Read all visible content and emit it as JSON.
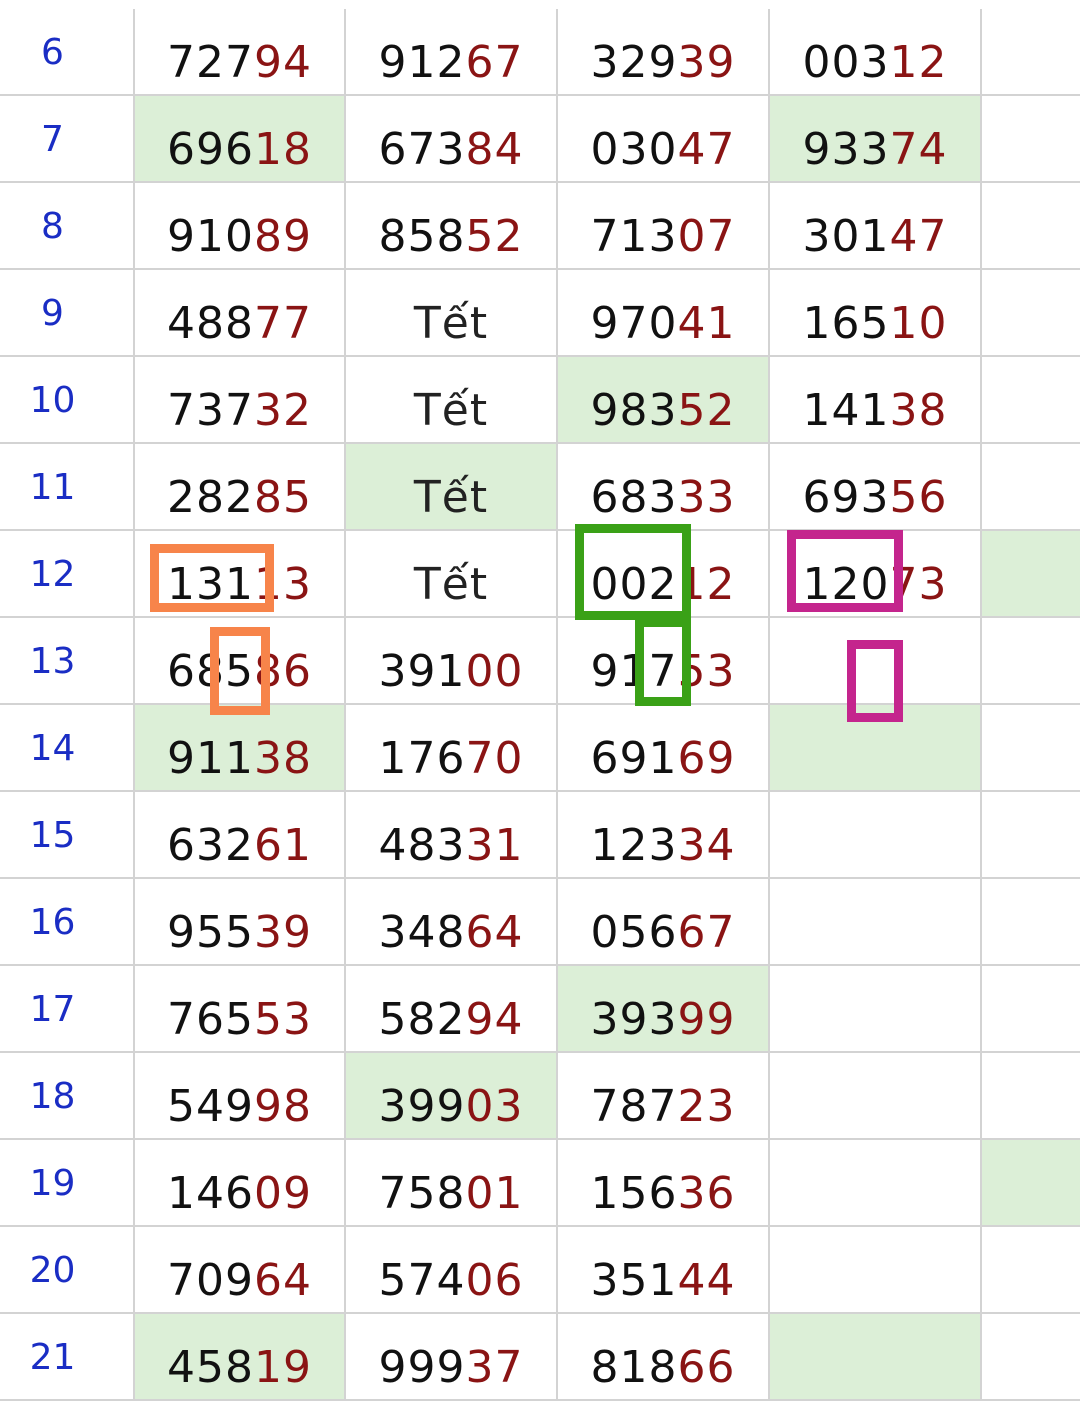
{
  "colors": {
    "day_text": "#1a2dc4",
    "number_text": "#111111",
    "tail_text": "#8a1414",
    "highlight_fill": "#dcefd7",
    "grid_line": "#d3d3d3",
    "mark_orange": "#f7844a",
    "mark_green": "#3aa117",
    "mark_magenta": "#c4258d"
  },
  "rows": [
    {
      "day": "6",
      "cells": [
        {
          "head": "727",
          "tail": "94"
        },
        {
          "head": "912",
          "tail": "67"
        },
        {
          "head": "329",
          "tail": "39"
        },
        {
          "head": "003",
          "tail": "12"
        },
        {
          "head": "",
          "tail": ""
        }
      ],
      "highlight": [
        false,
        false,
        false,
        false,
        false
      ]
    },
    {
      "day": "7",
      "cells": [
        {
          "head": "696",
          "tail": "18"
        },
        {
          "head": "673",
          "tail": "84"
        },
        {
          "head": "030",
          "tail": "47"
        },
        {
          "head": "933",
          "tail": "74"
        },
        {
          "head": "",
          "tail": ""
        }
      ],
      "highlight": [
        true,
        false,
        false,
        true,
        false
      ]
    },
    {
      "day": "8",
      "cells": [
        {
          "head": "910",
          "tail": "89"
        },
        {
          "head": "858",
          "tail": "52"
        },
        {
          "head": "713",
          "tail": "07"
        },
        {
          "head": "301",
          "tail": "47"
        },
        {
          "head": "",
          "tail": ""
        }
      ],
      "highlight": [
        false,
        false,
        false,
        false,
        false
      ]
    },
    {
      "day": "9",
      "cells": [
        {
          "head": "488",
          "tail": "77"
        },
        {
          "word": "Tết"
        },
        {
          "head": "970",
          "tail": "41"
        },
        {
          "head": "165",
          "tail": "10"
        },
        {
          "head": "",
          "tail": ""
        }
      ],
      "highlight": [
        false,
        false,
        false,
        false,
        false
      ]
    },
    {
      "day": "10",
      "cells": [
        {
          "head": "737",
          "tail": "32"
        },
        {
          "word": "Tết"
        },
        {
          "head": "983",
          "tail": "52"
        },
        {
          "head": "141",
          "tail": "38"
        },
        {
          "head": "",
          "tail": ""
        }
      ],
      "highlight": [
        false,
        false,
        true,
        false,
        false
      ]
    },
    {
      "day": "11",
      "cells": [
        {
          "head": "282",
          "tail": "85"
        },
        {
          "word": "Tết"
        },
        {
          "head": "683",
          "tail": "33"
        },
        {
          "head": "693",
          "tail": "56"
        },
        {
          "head": "",
          "tail": ""
        }
      ],
      "highlight": [
        false,
        true,
        false,
        false,
        false
      ]
    },
    {
      "day": "12",
      "cells": [
        {
          "head": "131",
          "tail": "13"
        },
        {
          "word": "Tết"
        },
        {
          "head": "002",
          "tail": "12"
        },
        {
          "head": "120",
          "tail": "73"
        },
        {
          "head": "",
          "tail": ""
        }
      ],
      "highlight": [
        false,
        false,
        false,
        false,
        true
      ]
    },
    {
      "day": "13",
      "cells": [
        {
          "head": "685",
          "tail": "86"
        },
        {
          "head": "391",
          "tail": "00"
        },
        {
          "head": "917",
          "tail": "53"
        },
        {
          "head": "",
          "tail": ""
        },
        {
          "head": "",
          "tail": ""
        }
      ],
      "highlight": [
        false,
        false,
        false,
        false,
        false
      ]
    },
    {
      "day": "14",
      "cells": [
        {
          "head": "911",
          "tail": "38"
        },
        {
          "head": "176",
          "tail": "70"
        },
        {
          "head": "691",
          "tail": "69"
        },
        {
          "head": "",
          "tail": ""
        },
        {
          "head": "",
          "tail": ""
        }
      ],
      "highlight": [
        true,
        false,
        false,
        true,
        false
      ]
    },
    {
      "day": "15",
      "cells": [
        {
          "head": "632",
          "tail": "61"
        },
        {
          "head": "483",
          "tail": "31"
        },
        {
          "head": "123",
          "tail": "34"
        },
        {
          "head": "",
          "tail": ""
        },
        {
          "head": "",
          "tail": ""
        }
      ],
      "highlight": [
        false,
        false,
        false,
        false,
        false
      ]
    },
    {
      "day": "16",
      "cells": [
        {
          "head": "955",
          "tail": "39"
        },
        {
          "head": "348",
          "tail": "64"
        },
        {
          "head": "056",
          "tail": "67"
        },
        {
          "head": "",
          "tail": ""
        },
        {
          "head": "",
          "tail": ""
        }
      ],
      "highlight": [
        false,
        false,
        false,
        false,
        false
      ]
    },
    {
      "day": "17",
      "cells": [
        {
          "head": "765",
          "tail": "53"
        },
        {
          "head": "582",
          "tail": "94"
        },
        {
          "head": "393",
          "tail": "99"
        },
        {
          "head": "",
          "tail": ""
        },
        {
          "head": "",
          "tail": ""
        }
      ],
      "highlight": [
        false,
        false,
        true,
        false,
        false
      ]
    },
    {
      "day": "18",
      "cells": [
        {
          "head": "549",
          "tail": "98"
        },
        {
          "head": "399",
          "tail": "03"
        },
        {
          "head": "787",
          "tail": "23"
        },
        {
          "head": "",
          "tail": ""
        },
        {
          "head": "",
          "tail": ""
        }
      ],
      "highlight": [
        false,
        true,
        false,
        false,
        false
      ]
    },
    {
      "day": "19",
      "cells": [
        {
          "head": "146",
          "tail": "09"
        },
        {
          "head": "758",
          "tail": "01"
        },
        {
          "head": "156",
          "tail": "36"
        },
        {
          "head": "",
          "tail": ""
        },
        {
          "head": "",
          "tail": ""
        }
      ],
      "highlight": [
        false,
        false,
        false,
        false,
        true
      ]
    },
    {
      "day": "20",
      "cells": [
        {
          "head": "709",
          "tail": "64"
        },
        {
          "head": "574",
          "tail": "06"
        },
        {
          "head": "351",
          "tail": "44"
        },
        {
          "head": "",
          "tail": ""
        },
        {
          "head": "",
          "tail": ""
        }
      ],
      "highlight": [
        false,
        false,
        false,
        false,
        false
      ]
    },
    {
      "day": "21",
      "cells": [
        {
          "head": "458",
          "tail": "19"
        },
        {
          "head": "999",
          "tail": "37"
        },
        {
          "head": "818",
          "tail": "66"
        },
        {
          "head": "",
          "tail": ""
        },
        {
          "head": "",
          "tail": ""
        }
      ],
      "highlight": [
        true,
        false,
        false,
        true,
        false
      ]
    }
  ],
  "annotations": [
    {
      "color": "orange",
      "kind": "rectangle-mark"
    },
    {
      "color": "orange",
      "kind": "rectangle-mark"
    },
    {
      "color": "green",
      "kind": "rectangle-mark"
    },
    {
      "color": "green",
      "kind": "rectangle-mark"
    },
    {
      "color": "magenta",
      "kind": "rectangle-mark"
    },
    {
      "color": "magenta",
      "kind": "rectangle-mark"
    }
  ]
}
